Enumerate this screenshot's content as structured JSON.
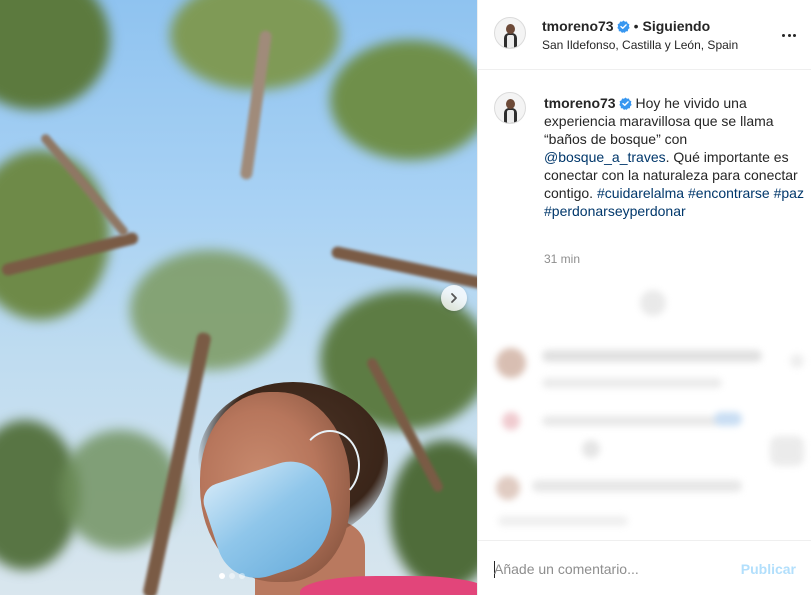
{
  "post": {
    "username": "tmoreno73",
    "separator": "•",
    "follow_status": "Siguiendo",
    "location": "San Ildefonso, Castilla y León, Spain",
    "caption": {
      "text_1": "Hoy he vivido una experiencia maravillosa que se llama “baños de bosque” con ",
      "mention": "@bosque_a_traves",
      "text_2": ". Qué importante es conectar con la naturaleza para conectar contigo. ",
      "hashtags": [
        "#cuidarelalma",
        "#encontrarse",
        "#paz",
        "#perdonarseyperdonar"
      ]
    },
    "time_ago": "31 min"
  },
  "carousel": {
    "slide_count": 3,
    "current_slide": 1
  },
  "comment_box": {
    "placeholder": "Añade un comentario...",
    "publish_label": "Publicar"
  },
  "icons": {
    "verified": "verified-badge-icon",
    "more": "more-options-icon",
    "next": "chevron-right-icon"
  },
  "colors": {
    "verified": "#3897f0",
    "link": "#00376b",
    "publish_disabled": "#b2dffc",
    "muted": "#8e8e8e"
  }
}
